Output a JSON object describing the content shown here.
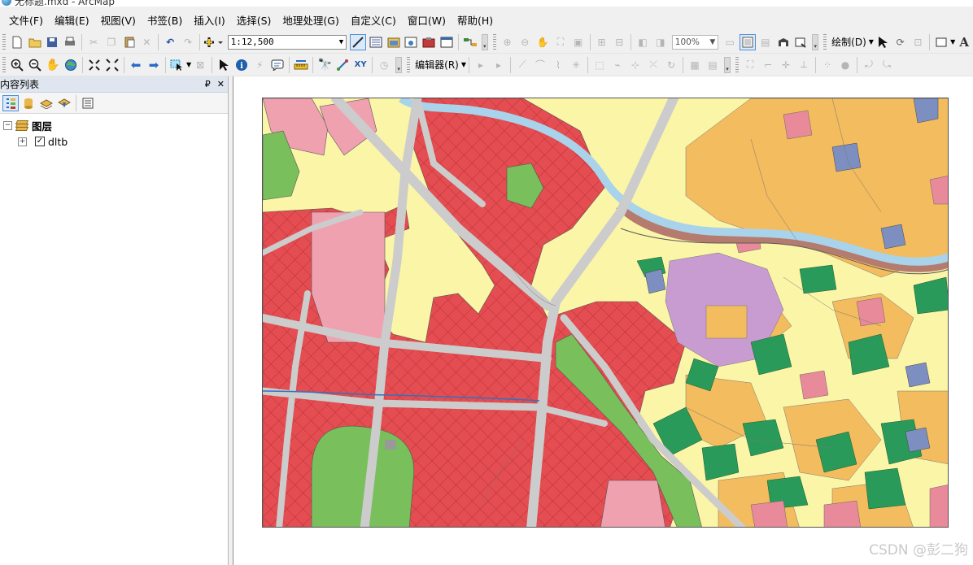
{
  "window": {
    "title": "无标题.mxd - ArcMap"
  },
  "menubar": {
    "items": [
      "文件(F)",
      "编辑(E)",
      "视图(V)",
      "书签(B)",
      "插入(I)",
      "选择(S)",
      "地理处理(G)",
      "自定义(C)",
      "窗口(W)",
      "帮助(H)"
    ]
  },
  "toolbar": {
    "scale_value": "1:12,500",
    "zoom_value": "100%",
    "draw_label": "绘制(D)",
    "editor_label": "编辑器(R)",
    "text_tool": "A",
    "xy_tool": "XY"
  },
  "toc": {
    "title": "内容列表",
    "root_label": "图层",
    "layer_label": "dltb",
    "layer_checked": true
  },
  "map": {
    "colors": {
      "construction_hatch": "#e44d51",
      "residential": "#f0a1b0",
      "roads": "#cccccc",
      "green": "#79bf5c",
      "dark_green": "#2a9a5a",
      "orange_farmland": "#f3bc5e",
      "pale_yellow": "#fbf5a8",
      "purple": "#c89bd1",
      "blue_gray": "#7d8fc1",
      "water": "#a9d3eb",
      "river_bank": "#b57b6e"
    }
  },
  "watermark": "CSDN @彭二狗"
}
